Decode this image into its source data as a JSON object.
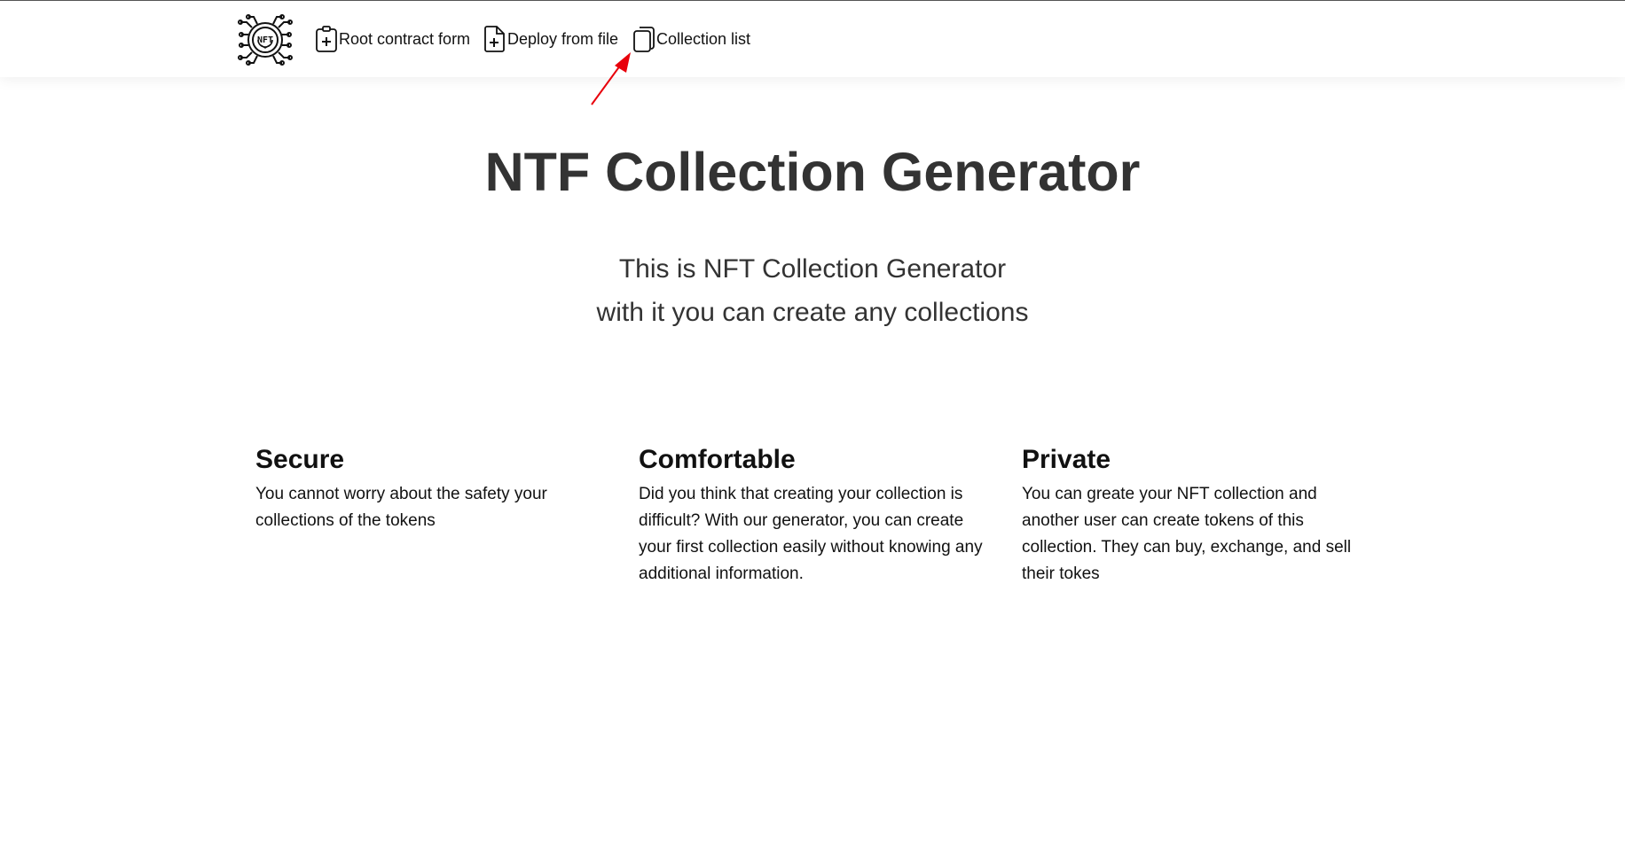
{
  "nav": {
    "logo_icon": "nft-circuit-logo-icon",
    "items": [
      {
        "label": "Root contract form",
        "icon": "clipboard-plus-icon"
      },
      {
        "label": "Deploy from file",
        "icon": "file-plus-icon"
      },
      {
        "label": "Collection list",
        "icon": "files-icon"
      }
    ]
  },
  "hero": {
    "title": "NTF Collection Generator",
    "subtitle_line1": "This is NFT Collection Generator",
    "subtitle_line2": "with it you can create any collections"
  },
  "features": [
    {
      "title": "Secure",
      "text": "You cannot worry about the safety your collections of the tokens"
    },
    {
      "title": "Comfortable",
      "text": "Did you think that creating your collection is difficult? With our generator, you can create your first collection easily without knowing any additional information."
    },
    {
      "title": "Private",
      "text": "You can greate your NFT collection and another user can create tokens of this collection. They can buy, exchange, and sell their tokes"
    }
  ],
  "colors": {
    "text": "#333333",
    "body_text": "#111111",
    "annotation_arrow": "#e8000b",
    "background": "#ffffff"
  }
}
